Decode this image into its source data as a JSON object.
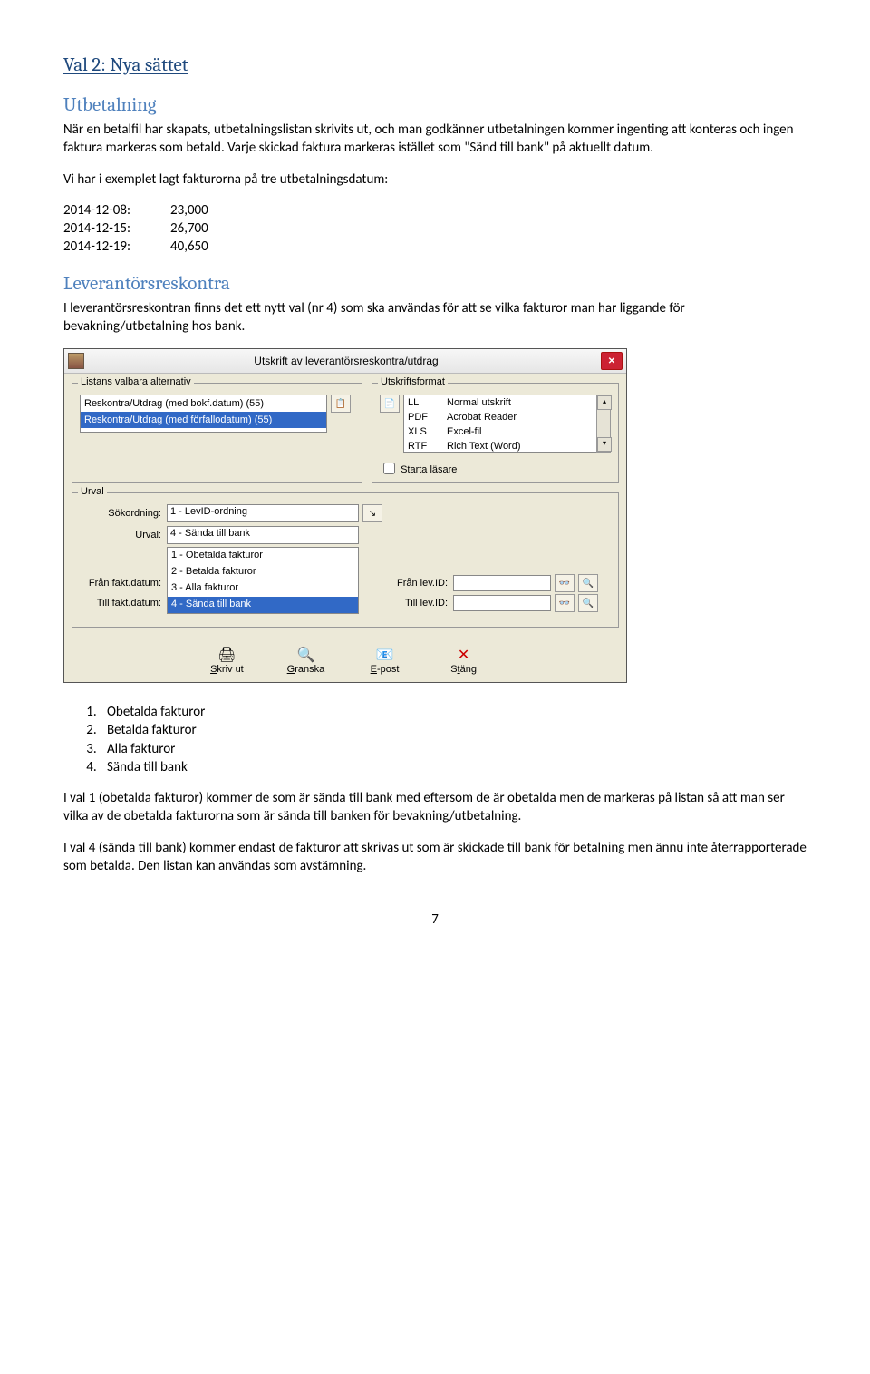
{
  "h1": "Val 2: Nya sättet",
  "sect1": {
    "h2": "Utbetalning",
    "p1": "När en betalfil har skapats, utbetalningslistan skrivits ut, och man godkänner utbetalningen kommer ingenting att konteras och ingen faktura markeras som betald. Varje skickad faktura markeras istället som \"Sänd till bank\" på aktuellt datum.",
    "p2": "Vi har i exemplet lagt fakturorna på tre utbetalningsdatum:",
    "rows": [
      {
        "d": "2014-12-08:",
        "v": "23,000"
      },
      {
        "d": "2014-12-15:",
        "v": "26,700"
      },
      {
        "d": "2014-12-19:",
        "v": "40,650"
      }
    ]
  },
  "sect2": {
    "h2": "Leverantörsreskontra",
    "p1": "I leverantörsreskontran finns det ett nytt val (nr 4) som ska användas för att se vilka fakturor man har liggande för bevakning/utbetalning hos bank."
  },
  "dialog": {
    "title": "Utskrift av leverantörsreskontra/utdrag",
    "grp1_legend": "Listans valbara alternativ",
    "list": [
      "Reskontra/Utdrag (med bokf.datum) (55)",
      "Reskontra/Utdrag (med förfallodatum) (55)"
    ],
    "grp2_legend": "Utskriftsformat",
    "formats": [
      {
        "c": "LL",
        "d": "Normal utskrift"
      },
      {
        "c": "PDF",
        "d": "Acrobat Reader"
      },
      {
        "c": "XLS",
        "d": "Excel-fil"
      },
      {
        "c": "RTF",
        "d": "Rich Text (Word)"
      }
    ],
    "starta": "Starta läsare",
    "urval_legend": "Urval",
    "lbl_sokordning": "Sökordning:",
    "val_sokordning": "1  - LevID-ordning",
    "lbl_urval": "Urval:",
    "val_urval": "4  - Sända till bank",
    "lbl_franfakt": "Från fakt.datum:",
    "lbl_tillfakt": "Till fakt.datum:",
    "lbl_franlev": "Från lev.ID:",
    "lbl_tilllev": "Till lev.ID:",
    "options": [
      "1  - Obetalda fakturor",
      "2  - Betalda fakturor",
      "3  - Alla fakturor",
      "4  - Sända till bank"
    ],
    "btn_skriv": "Skriv ut",
    "btn_granska": "Granska",
    "btn_epost": "E-post",
    "btn_stang": "Stäng"
  },
  "list_items": [
    "Obetalda fakturor",
    "Betalda fakturor",
    "Alla fakturor",
    "Sända till bank"
  ],
  "p_after1": "I val 1 (obetalda fakturor) kommer de som är sända till bank med eftersom de är obetalda men de markeras på listan så att man ser vilka av de obetalda fakturorna som är sända till banken för bevakning/utbetalning.",
  "p_after2": "I val 4 (sända till bank) kommer endast de fakturor att skrivas ut som är skickade till bank för betalning men ännu inte återrapporterade som betalda. Den listan kan användas som avstämning.",
  "page_number": "7"
}
